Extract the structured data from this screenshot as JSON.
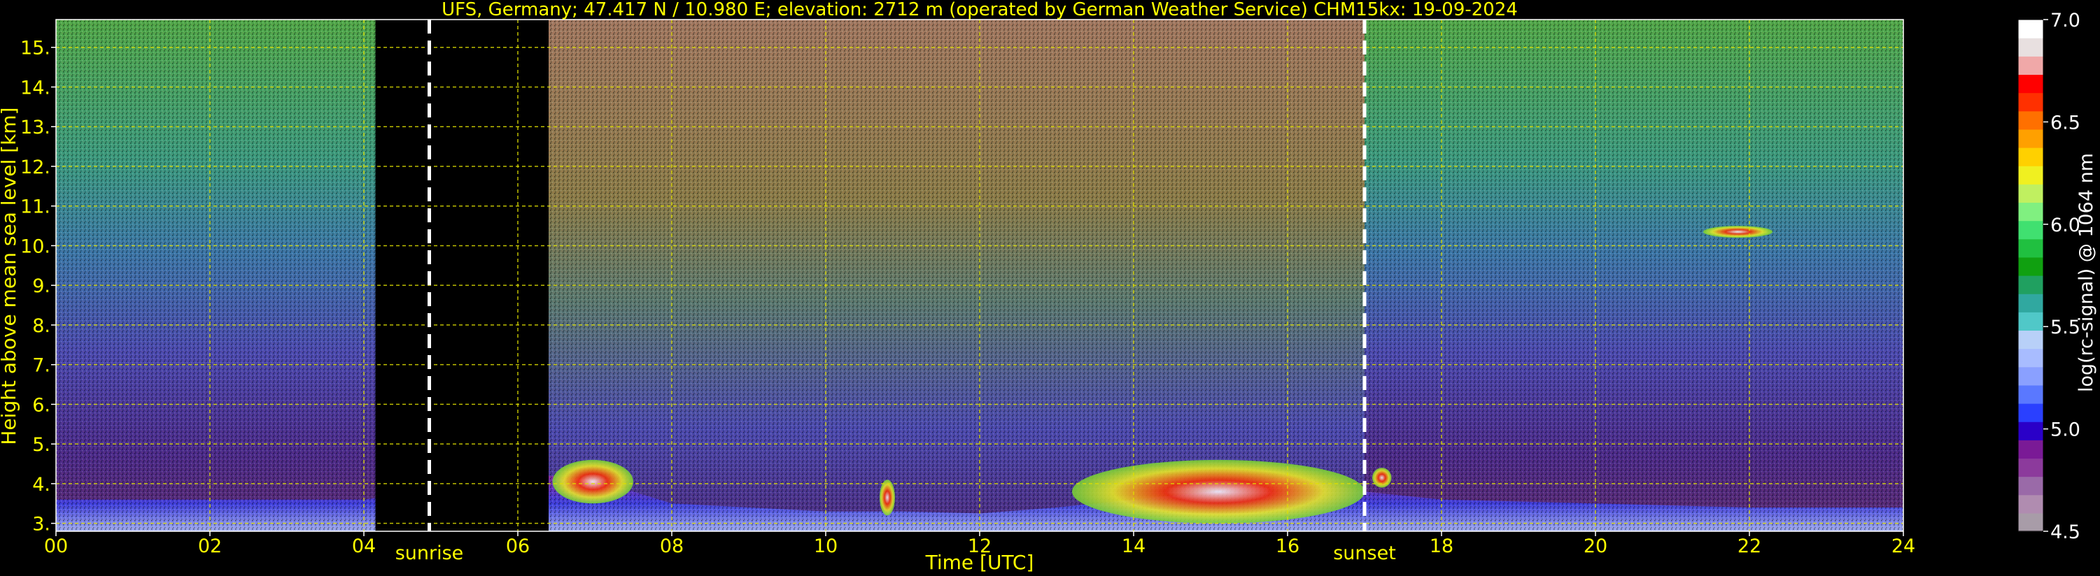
{
  "chart_data": {
    "type": "heatmap",
    "title": "UFS, Germany; 47.417 N / 10.980 E; elevation: 2712 m  (operated by German Weather Service)    CHM15kx: 19-09-2024",
    "xlabel": "Time [UTC]",
    "ylabel": "Height above mean sea level [km]",
    "colorbar_label": "log(rc-signal) @ 1064 nm",
    "xlim": [
      0,
      24
    ],
    "ylim": [
      2.8,
      15.7
    ],
    "x_ticks": [
      "00",
      "02",
      "04",
      "06",
      "08",
      "10",
      "12",
      "14",
      "16",
      "18",
      "20",
      "22",
      "24"
    ],
    "y_ticks": [
      "3.",
      "4.",
      "5.",
      "6.",
      "7.",
      "8.",
      "9.",
      "10.",
      "11.",
      "12.",
      "13.",
      "14.",
      "15."
    ],
    "colorbar_range": [
      4.5,
      7.0
    ],
    "colorbar_ticks": [
      "4.5",
      "5.0",
      "5.5",
      "6.0",
      "6.5",
      "7.0"
    ],
    "colorbar_colors": [
      "#a89ca8",
      "#b08cb0",
      "#9a6aa8",
      "#8c3a9c",
      "#7a1a96",
      "#2a00c8",
      "#2a40ff",
      "#5a78ff",
      "#8aa0ff",
      "#a8bcff",
      "#b8d0f8",
      "#50c8c8",
      "#30a8a0",
      "#20a060",
      "#10a010",
      "#20c040",
      "#40e070",
      "#80f080",
      "#c0f060",
      "#f0f020",
      "#ffd000",
      "#ffa000",
      "#ff7000",
      "#ff3000",
      "#ff0000",
      "#f0a8a8",
      "#e8e0e0",
      "#ffffff"
    ],
    "grid": true,
    "grid_color": "#e0e000",
    "text_color": "#ffff00",
    "annotations": [
      {
        "label": "sunrise",
        "x": 4.85
      },
      {
        "label": "sunset",
        "x": 17.0
      }
    ],
    "no_data_gaps": [
      [
        4.15,
        6.4
      ]
    ],
    "boundary_layer_top_km": [
      [
        0,
        3.6
      ],
      [
        2,
        3.6
      ],
      [
        4,
        3.6
      ],
      [
        6.4,
        4.2
      ],
      [
        7,
        4.1
      ],
      [
        8,
        3.5
      ],
      [
        9,
        3.4
      ],
      [
        10,
        3.3
      ],
      [
        11,
        3.3
      ],
      [
        12,
        3.25
      ],
      [
        13,
        3.4
      ],
      [
        14,
        3.6
      ],
      [
        15,
        3.8
      ],
      [
        16,
        4.2
      ],
      [
        17,
        3.8
      ],
      [
        18,
        3.6
      ],
      [
        20,
        3.5
      ],
      [
        22,
        3.4
      ],
      [
        24,
        3.4
      ]
    ],
    "cloud_features": [
      {
        "x_start": 6.45,
        "x_end": 7.5,
        "base_km": 3.5,
        "top_km": 4.6
      },
      {
        "x_start": 10.7,
        "x_end": 10.9,
        "base_km": 3.2,
        "top_km": 4.1
      },
      {
        "x_start": 13.2,
        "x_end": 17.0,
        "base_km": 3.0,
        "top_km": 4.6
      },
      {
        "x_start": 17.1,
        "x_end": 17.35,
        "base_km": 3.9,
        "top_km": 4.4
      },
      {
        "x_start": 21.4,
        "x_end": 22.3,
        "base_km": 10.2,
        "top_km": 10.5
      }
    ]
  }
}
